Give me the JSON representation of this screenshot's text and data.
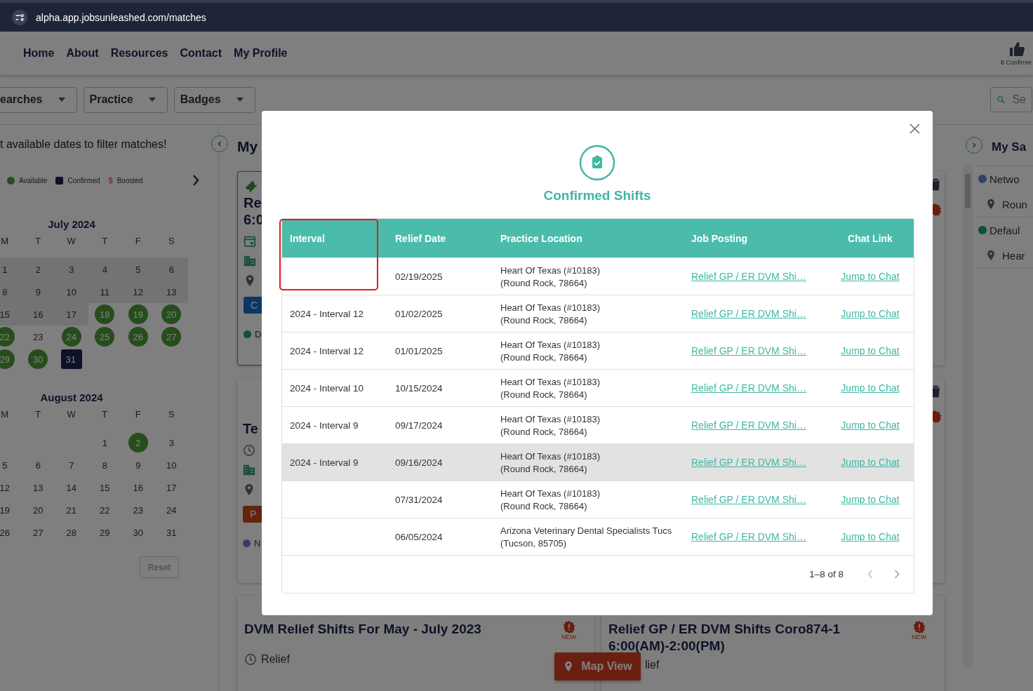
{
  "browser": {
    "url": "alpha.app.jobsunleashed.com/matches"
  },
  "nav": {
    "links": [
      "Home",
      "About",
      "Resources",
      "Contact",
      "My Profile"
    ],
    "confirmed_label": "8 Confirme"
  },
  "filters": [
    "earches",
    "Practice",
    "Badges"
  ],
  "search_button": {
    "label": "Se"
  },
  "calendar_panel": {
    "hint": "t available dates to filter matches!",
    "legend": [
      {
        "kind": "dot",
        "label": "Available"
      },
      {
        "kind": "square",
        "label": "Confirmed"
      },
      {
        "kind": "dollar",
        "symbol": "$",
        "label": "Boosted"
      }
    ],
    "months": [
      {
        "title": "July 2024",
        "weekdays": [
          "M",
          "T",
          "W",
          "T",
          "F",
          "S"
        ],
        "weeks": [
          [
            {
              "day": "1",
              "kind": "past"
            },
            {
              "day": "2",
              "kind": "past"
            },
            {
              "day": "3",
              "kind": "past"
            },
            {
              "day": "4",
              "kind": "past"
            },
            {
              "day": "5",
              "kind": "past"
            },
            {
              "day": "6",
              "kind": "past"
            }
          ],
          [
            {
              "day": "8",
              "kind": "past"
            },
            {
              "day": "9",
              "kind": "past"
            },
            {
              "day": "10",
              "kind": "past"
            },
            {
              "day": "11",
              "kind": "past"
            },
            {
              "day": "12",
              "kind": "past"
            },
            {
              "day": "13",
              "kind": "past"
            }
          ],
          [
            {
              "day": "15",
              "kind": "past"
            },
            {
              "day": "16",
              "kind": "past"
            },
            {
              "day": "17",
              "kind": "past"
            },
            {
              "day": "18",
              "kind": "available"
            },
            {
              "day": "19",
              "kind": "available"
            },
            {
              "day": "20",
              "kind": "available"
            }
          ],
          [
            {
              "day": "22",
              "kind": "available"
            },
            {
              "day": "23",
              "kind": "plain"
            },
            {
              "day": "24",
              "kind": "available"
            },
            {
              "day": "25",
              "kind": "available"
            },
            {
              "day": "26",
              "kind": "available"
            },
            {
              "day": "27",
              "kind": "available"
            }
          ],
          [
            {
              "day": "29",
              "kind": "available"
            },
            {
              "day": "30",
              "kind": "available"
            },
            {
              "day": "31",
              "kind": "confirmed"
            },
            {
              "kind": "empty"
            },
            {
              "kind": "empty"
            },
            {
              "kind": "empty"
            }
          ]
        ]
      },
      {
        "title": "August 2024",
        "weekdays": [
          "M",
          "T",
          "W",
          "T",
          "F",
          "S"
        ],
        "weeks": [
          [
            {
              "kind": "empty"
            },
            {
              "kind": "empty"
            },
            {
              "kind": "empty"
            },
            {
              "day": "1",
              "kind": "plain"
            },
            {
              "day": "2",
              "kind": "available"
            },
            {
              "day": "3",
              "kind": "plain"
            }
          ],
          [
            {
              "day": "5",
              "kind": "plain"
            },
            {
              "day": "6",
              "kind": "plain"
            },
            {
              "day": "7",
              "kind": "plain"
            },
            {
              "day": "8",
              "kind": "plain"
            },
            {
              "day": "9",
              "kind": "plain"
            },
            {
              "day": "10",
              "kind": "plain"
            }
          ],
          [
            {
              "day": "12",
              "kind": "plain"
            },
            {
              "day": "13",
              "kind": "plain"
            },
            {
              "day": "14",
              "kind": "plain"
            },
            {
              "day": "15",
              "kind": "plain"
            },
            {
              "day": "16",
              "kind": "plain"
            },
            {
              "day": "17",
              "kind": "plain"
            }
          ],
          [
            {
              "day": "19",
              "kind": "plain"
            },
            {
              "day": "20",
              "kind": "plain"
            },
            {
              "day": "21",
              "kind": "plain"
            },
            {
              "day": "22",
              "kind": "plain"
            },
            {
              "day": "23",
              "kind": "plain"
            },
            {
              "day": "24",
              "kind": "plain"
            }
          ],
          [
            {
              "day": "26",
              "kind": "plain"
            },
            {
              "day": "27",
              "kind": "plain"
            },
            {
              "day": "28",
              "kind": "plain"
            },
            {
              "day": "29",
              "kind": "plain"
            },
            {
              "day": "30",
              "kind": "plain"
            },
            {
              "day": "31",
              "kind": "plain"
            }
          ]
        ]
      }
    ],
    "reset": "Reset"
  },
  "matches": {
    "heading": "My",
    "cards": [
      {
        "kind": "dated",
        "featured": true,
        "title_lines": [
          "Re",
          "6:0"
        ],
        "chip": {
          "label": "C",
          "kind": "confirmed"
        },
        "status": {
          "label": "D",
          "kind": "default"
        }
      },
      {
        "kind": "timed",
        "featured": false,
        "title_lines": [
          "Te"
        ],
        "chip": {
          "label": "P",
          "kind": "pending"
        },
        "status": {
          "label": "N",
          "kind": "network"
        }
      }
    ],
    "bottom_cards": [
      {
        "title_lines": [
          "DVM Relief Shifts For May - July 2023"
        ],
        "badge": "NEW",
        "detail": "Relief"
      },
      {
        "title_lines": [
          "Relief GP / ER DVM Shifts Coro874-1",
          "6:00(AM)-2:00(PM)"
        ],
        "badge": "NEW",
        "detail": "lief"
      }
    ]
  },
  "saved_panel": {
    "heading": "My Sa",
    "items": [
      {
        "kind": "network-group",
        "label": "Netwo"
      },
      {
        "kind": "place",
        "label": "Roun"
      },
      {
        "kind": "default-group",
        "label": "Defaul"
      },
      {
        "kind": "place",
        "label": "Hear"
      }
    ]
  },
  "map_button": "Map View",
  "modal": {
    "title": "Confirmed Shifts",
    "interval_highlighted": true,
    "columns": [
      "Interval",
      "Relief Date",
      "Practice Location",
      "Job Posting",
      "Chat Link"
    ],
    "rows": [
      {
        "date": "02/19/2025",
        "location_lines": [
          "Heart Of Texas (#10183)",
          "(Round Rock, 78664)"
        ],
        "job": "Relief GP / ER DVM Shi…",
        "chat": "Jump to Chat",
        "hovered": false
      },
      {
        "interval": "2024 - Interval 12",
        "date": "01/02/2025",
        "location_lines": [
          "Heart Of Texas (#10183)",
          "(Round Rock, 78664)"
        ],
        "job": "Relief GP / ER DVM Shi…",
        "chat": "Jump to Chat",
        "hovered": false
      },
      {
        "interval": "2024 - Interval 12",
        "date": "01/01/2025",
        "location_lines": [
          "Heart Of Texas (#10183)",
          "(Round Rock, 78664)"
        ],
        "job": "Relief GP / ER DVM Shi…",
        "chat": "Jump to Chat",
        "hovered": false
      },
      {
        "interval": "2024 - Interval 10",
        "date": "10/15/2024",
        "location_lines": [
          "Heart Of Texas (#10183)",
          "(Round Rock, 78664)"
        ],
        "job": "Relief GP / ER DVM Shi…",
        "chat": "Jump to Chat",
        "hovered": false
      },
      {
        "interval": "2024 - Interval 9",
        "date": "09/17/2024",
        "location_lines": [
          "Heart Of Texas (#10183)",
          "(Round Rock, 78664)"
        ],
        "job": "Relief GP / ER DVM Shi…",
        "chat": "Jump to Chat",
        "hovered": false
      },
      {
        "interval": "2024 - Interval 9",
        "date": "09/16/2024",
        "location_lines": [
          "Heart Of Texas (#10183)",
          "(Round Rock, 78664)"
        ],
        "job": "Relief GP / ER DVM Shi…",
        "chat": "Jump to Chat",
        "hovered": true
      },
      {
        "date": "07/31/2024",
        "location_lines": [
          "Heart Of Texas (#10183)",
          "(Round Rock, 78664)"
        ],
        "job": "Relief GP / ER DVM Shi…",
        "chat": "Jump to Chat",
        "hovered": false
      },
      {
        "date": "06/05/2024",
        "location_lines": [
          "Arizona Veterinary Dental Specialists Tucs",
          "(Tucson, 85705)"
        ],
        "job": "Relief GP / ER DVM Shi…",
        "chat": "Jump to Chat",
        "hovered": false
      }
    ],
    "pagination": "1–8 of 8"
  }
}
